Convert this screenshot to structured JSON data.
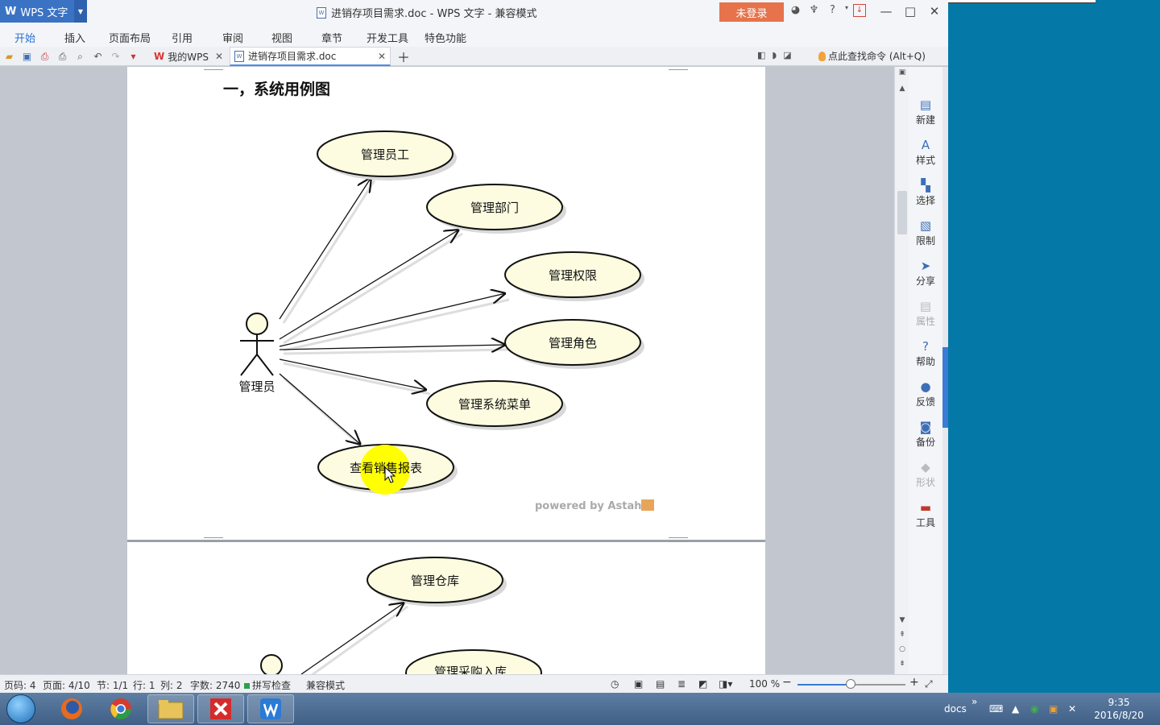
{
  "titlebar": {
    "app_name": "WPS 文字",
    "document_title": "进销存项目需求.doc - WPS 文字 - 兼容模式",
    "login_button": "未登录"
  },
  "menu": {
    "items": [
      "开始",
      "插入",
      "页面布局",
      "引用",
      "审阅",
      "视图",
      "章节",
      "开发工具",
      "特色功能"
    ],
    "active": "开始"
  },
  "tabs": {
    "my_wps": "我的WPS",
    "document": "进销存项目需求.doc",
    "search_command": "点此查找命令 (Alt+Q)"
  },
  "document": {
    "heading": "一，系统用例图",
    "actor_label": "管理员",
    "use_cases": [
      "管理员工",
      "管理部门",
      "管理权限",
      "管理角色",
      "管理系统菜单",
      "查看销售报表"
    ],
    "powered_by": "powered by Astah",
    "page2_use_cases": [
      "管理仓库",
      "管理采购入库"
    ]
  },
  "side_panel": {
    "items": [
      "新建",
      "样式",
      "选择",
      "限制",
      "分享",
      "属性",
      "帮助",
      "反馈",
      "备份",
      "形状",
      "工具"
    ],
    "disabled": [
      "属性",
      "形状"
    ]
  },
  "status": {
    "page_code": "页码: 4",
    "pages": "页面: 4/10",
    "section": "节: 1/1",
    "line": "行: 1",
    "column": "列: 2",
    "word_count": "字数: 2740",
    "spell_check": "拼写检查",
    "compat_mode": "兼容模式",
    "zoom": "100 %",
    "zoom_fraction": 0.5
  },
  "taskbar": {
    "tray_label": "docs",
    "time": "9:35",
    "date": "2016/8/20"
  },
  "colors": {
    "accent": "#3b73c4",
    "login": "#e6734b",
    "use_case_fill": "#fdfce0",
    "cursor_highlight": "#ffff00",
    "desktop": "#0479a8"
  }
}
